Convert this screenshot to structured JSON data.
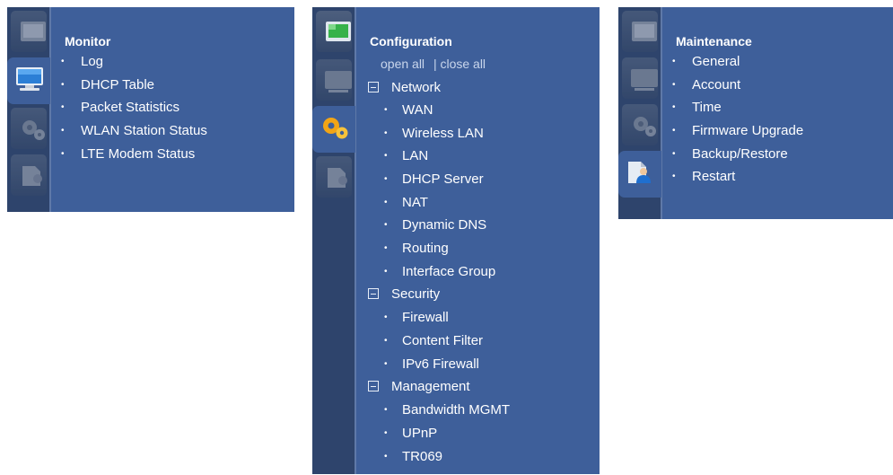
{
  "monitor": {
    "title": "Monitor",
    "items": [
      "Log",
      "DHCP Table",
      "Packet Statistics",
      "WLAN Station Status",
      "LTE Modem Status"
    ]
  },
  "configuration": {
    "title": "Configuration",
    "open_all": "open all",
    "close_all": "| close all",
    "groups": [
      {
        "label": "Network",
        "items": [
          "WAN",
          "Wireless LAN",
          "LAN",
          "DHCP Server",
          "NAT",
          "Dynamic DNS",
          "Routing",
          "Interface Group"
        ]
      },
      {
        "label": "Security",
        "items": [
          "Firewall",
          "Content Filter",
          "IPv6 Firewall"
        ]
      },
      {
        "label": "Management",
        "items": [
          "Bandwidth MGMT",
          "UPnP",
          "TR069"
        ]
      }
    ]
  },
  "maintenance": {
    "title": "Maintenance",
    "items": [
      "General",
      "Account",
      "Time",
      "Firmware Upgrade",
      "Backup/Restore",
      "Restart"
    ]
  },
  "icons": {
    "monitor": "monitor-icon",
    "configuration": "gears-icon",
    "maintenance": "maintenance-icon",
    "status": "status-icon"
  },
  "colors": {
    "panel": "#3e5f9a",
    "rail": "#2e446c",
    "text": "#ffffff"
  }
}
